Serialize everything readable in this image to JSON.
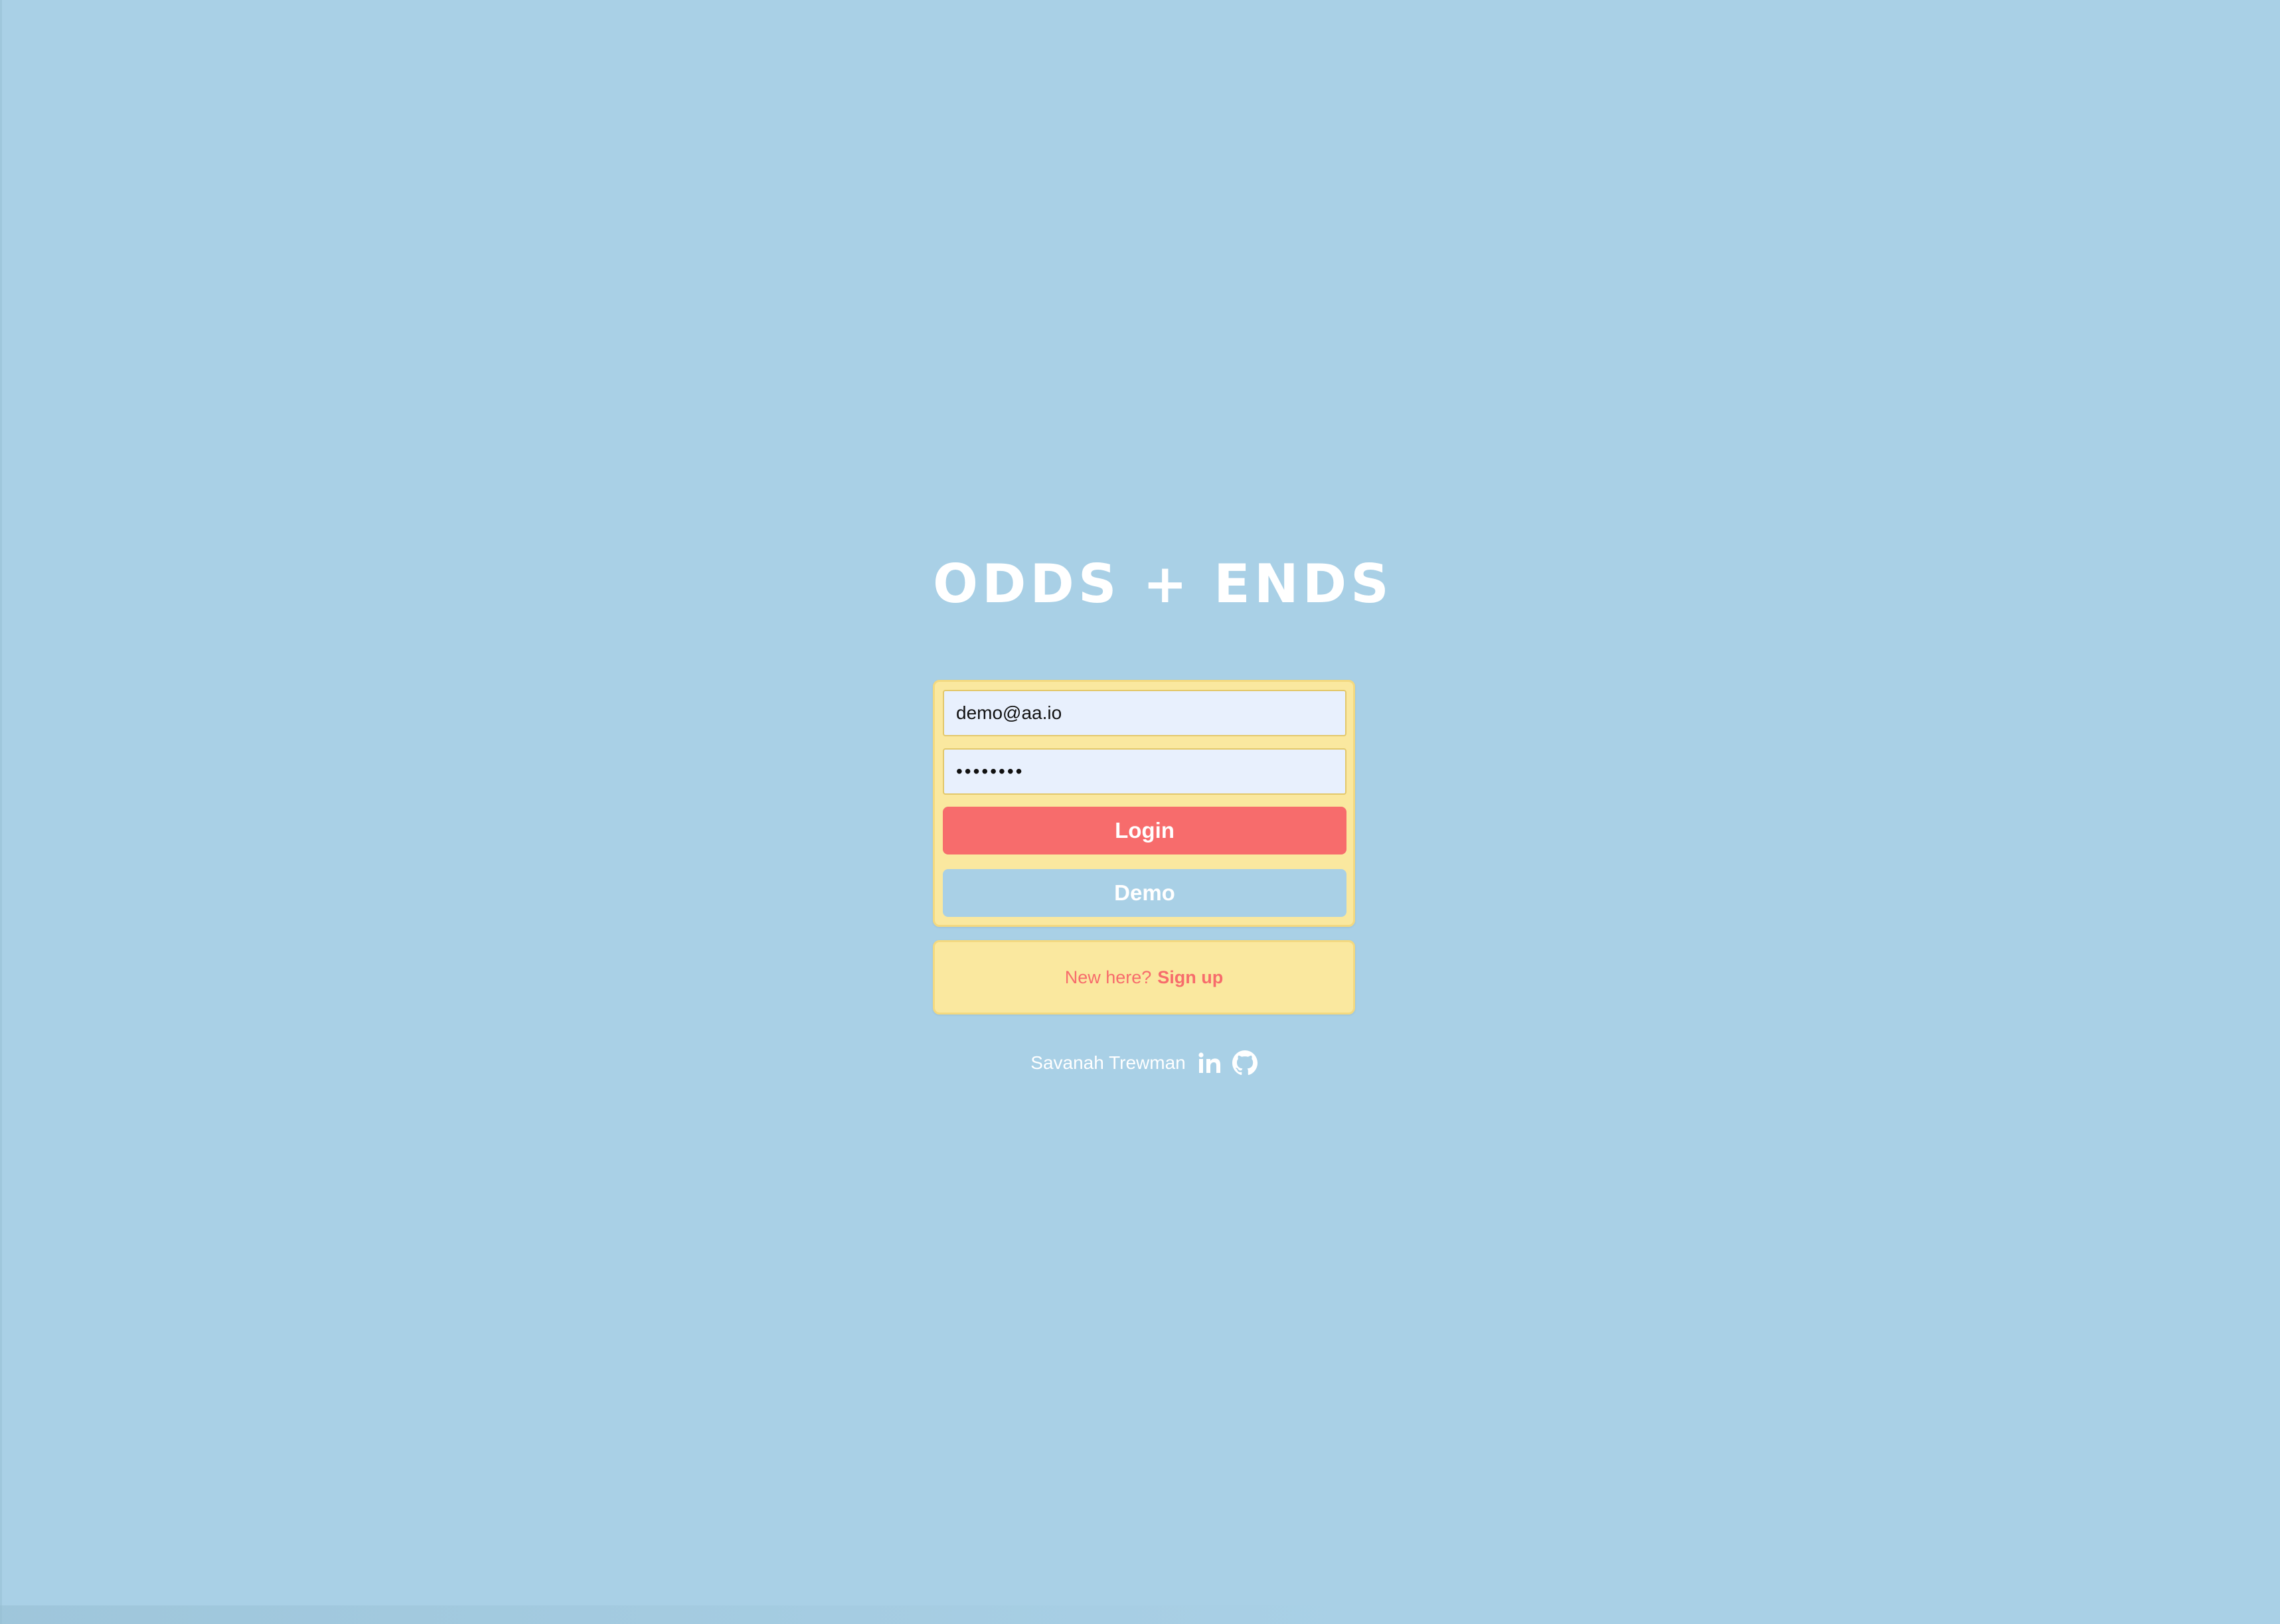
{
  "app": {
    "logo_text": "ODDS + ENDS"
  },
  "login_form": {
    "email_value": "demo@aa.io",
    "password_value": "password",
    "login_label": "Login",
    "demo_label": "Demo"
  },
  "signup": {
    "prompt": "New here?",
    "link_label": "Sign up"
  },
  "footer": {
    "author": "Savanah Trewman",
    "icons": [
      "linkedin-icon",
      "github-icon"
    ]
  },
  "colors": {
    "background": "#a9d0e6",
    "card": "#fae89f",
    "accent": "#f76c6c",
    "input_bg": "#e8f0fd"
  }
}
